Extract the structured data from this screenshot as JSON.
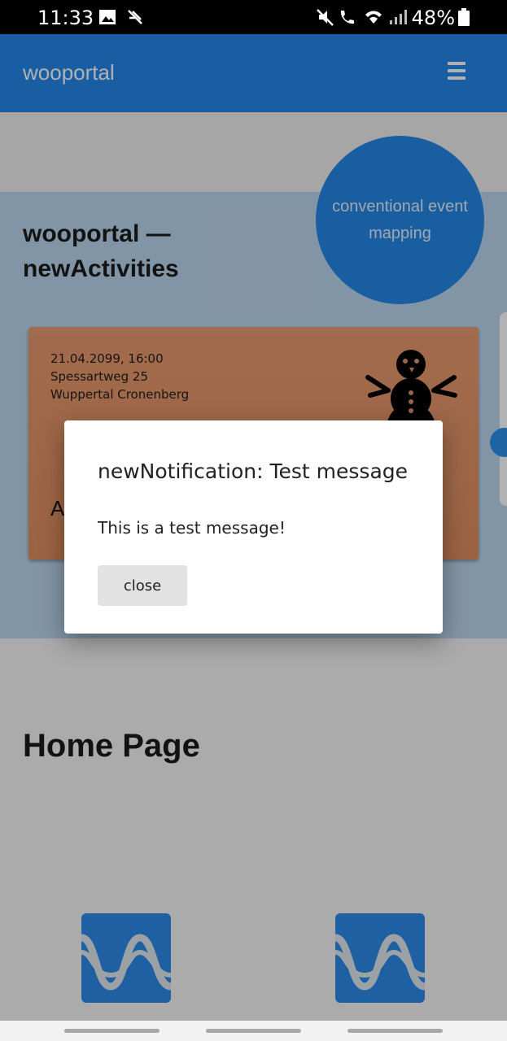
{
  "status_bar": {
    "time": "11:33",
    "battery": "48%",
    "left_icons": [
      "image-icon",
      "no-signal-icon"
    ],
    "right_icons": [
      "mute-icon",
      "wifi-call-icon",
      "wifi-icon",
      "signal-icon",
      "battery-icon"
    ]
  },
  "appbar": {
    "brand": "wooportal",
    "menu_icon": "hamburger-icon"
  },
  "activities": {
    "title": "wooportal — newActivities",
    "mapping_button": "conventional event mapping",
    "card": {
      "datetime": "21.04.2099, 16:00",
      "street": "Spessartweg 25",
      "city": "Wuppertal Cronenberg",
      "title_partial": "A",
      "icon": "snowman-icon"
    }
  },
  "home": {
    "title": "Home Page",
    "logos": [
      "wooportal-logo-icon",
      "wooportal-logo-icon"
    ]
  },
  "dialog": {
    "title": "newNotification: Test message",
    "body": "This is a test message!",
    "close_label": "close"
  },
  "colors": {
    "primary": "#2383e2",
    "card": "#d98c5f",
    "dialog_bg": "#ffffff",
    "button_bg": "#e2e2e2"
  }
}
